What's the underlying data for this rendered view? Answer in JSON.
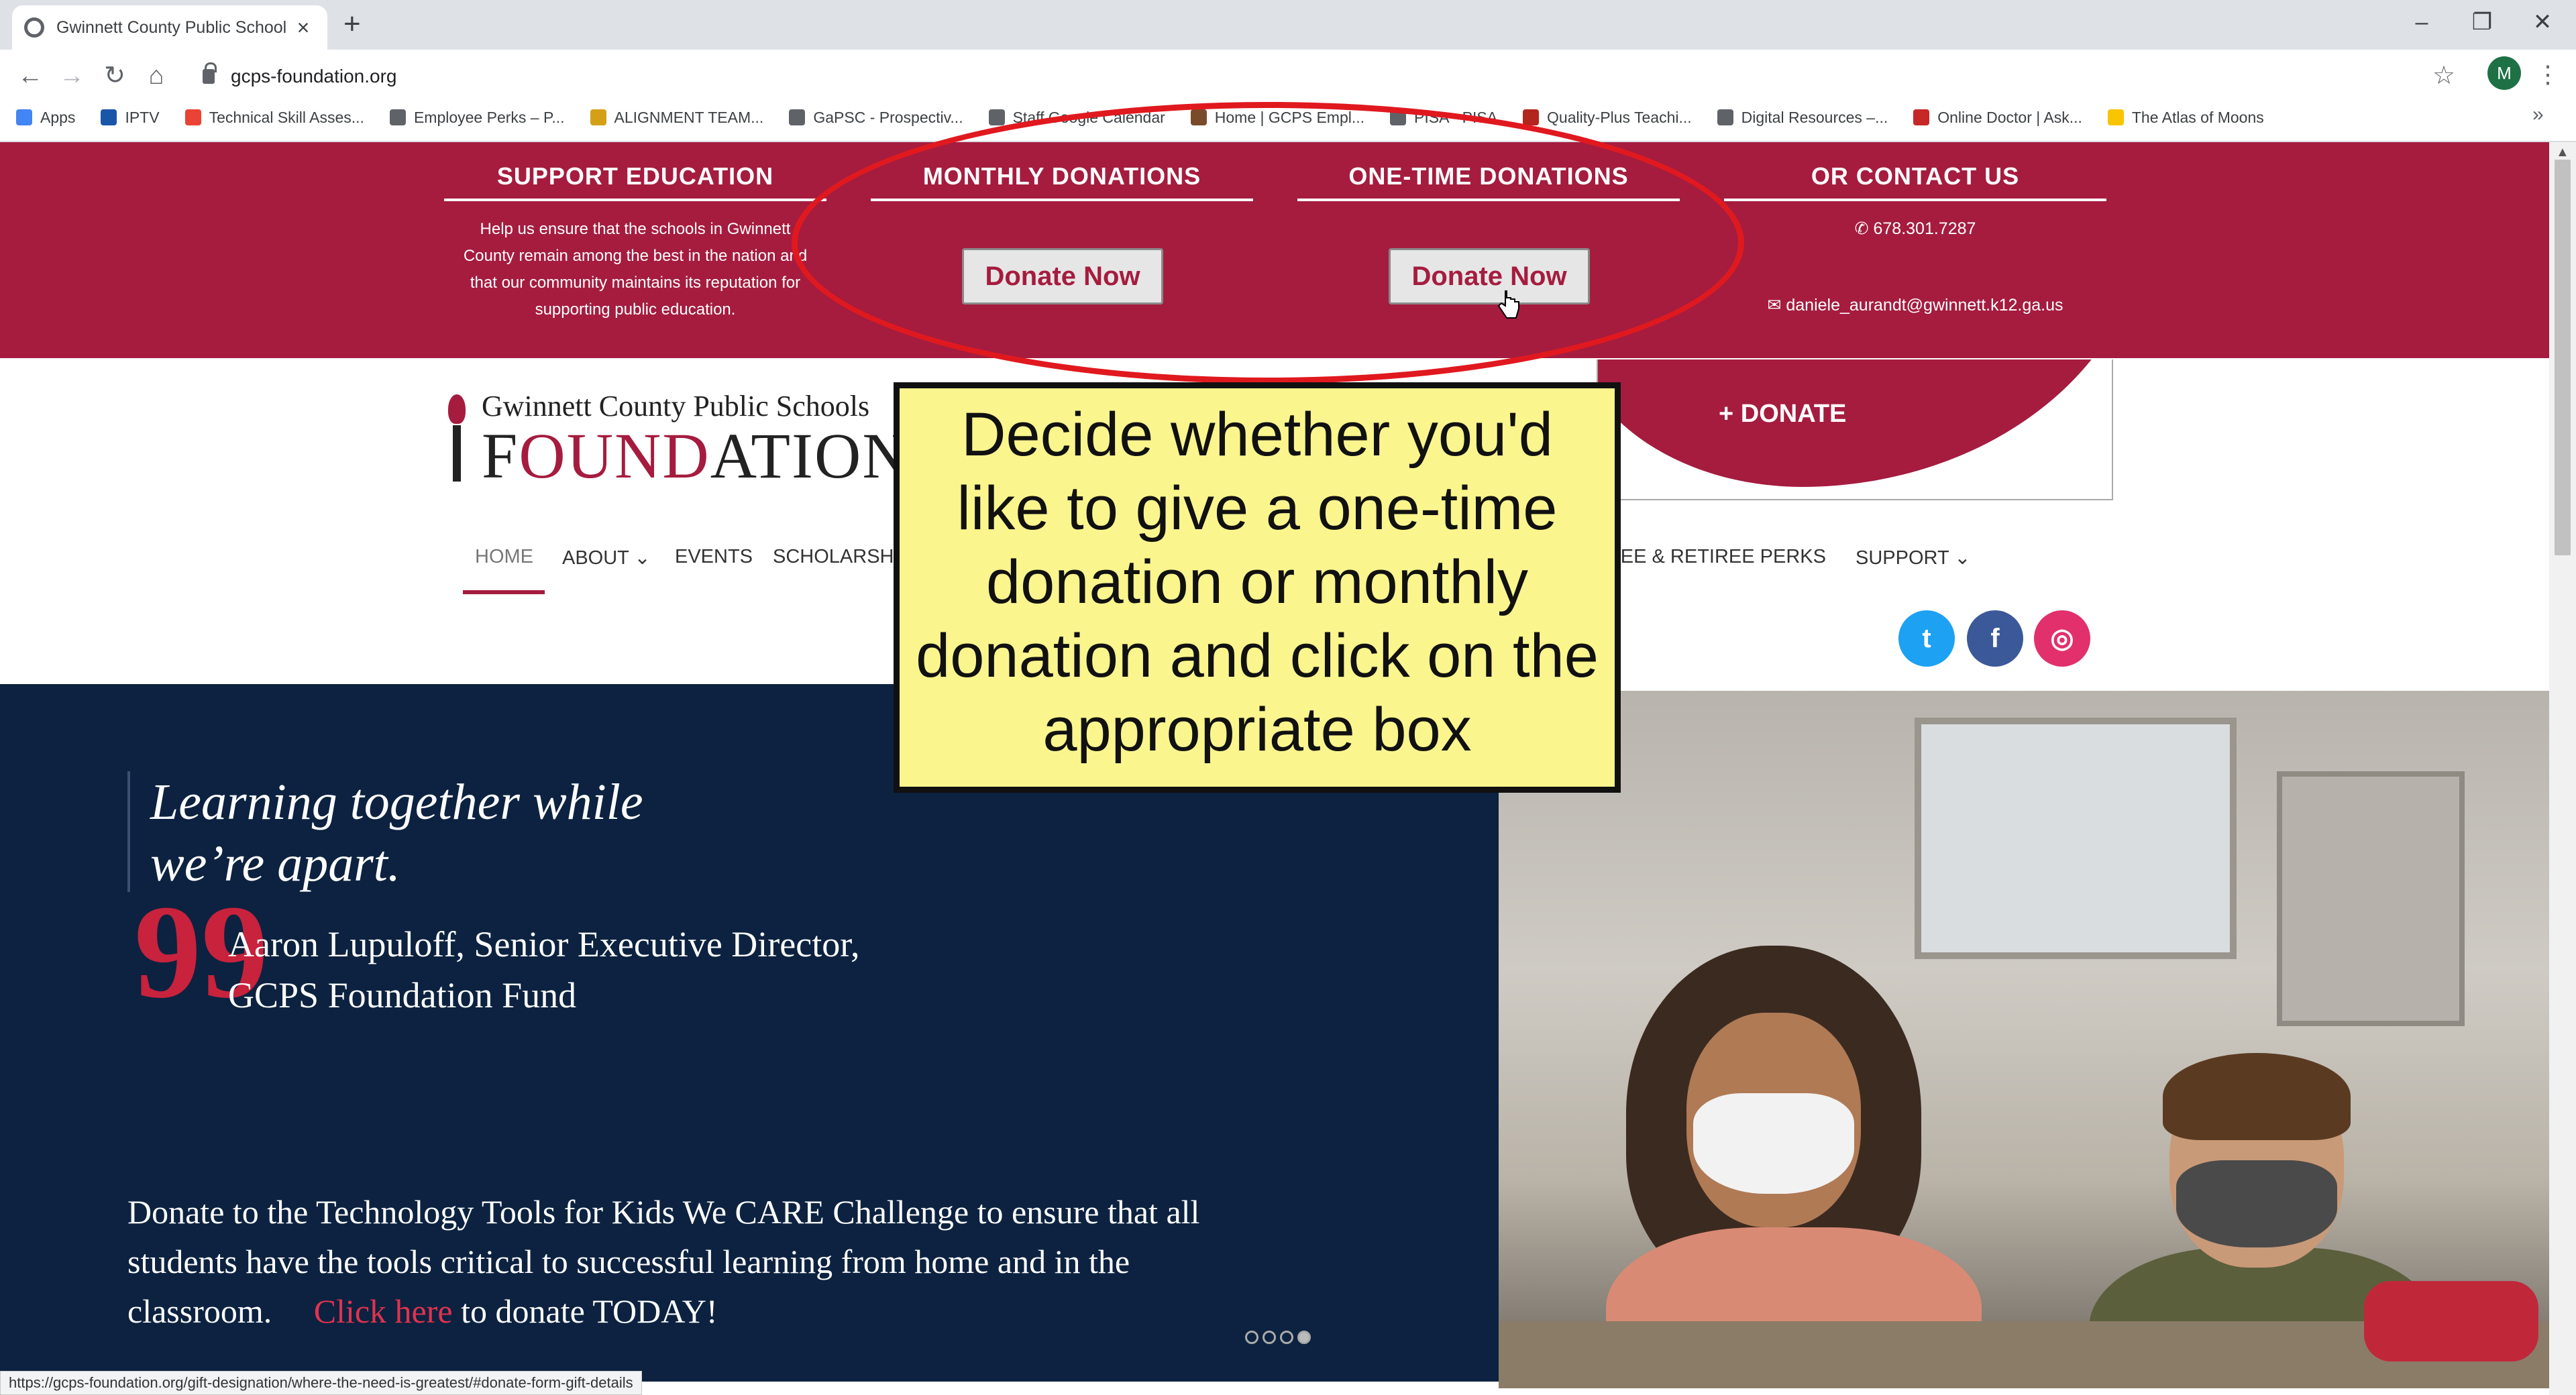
{
  "browser": {
    "tab_title": "Gwinnett County Public School F",
    "tab_close": "×",
    "new_tab": "+",
    "url": "gcps-foundation.org",
    "profile_initial": "M",
    "bookmarks": [
      {
        "label": "Apps",
        "color": "#4285f4"
      },
      {
        "label": "IPTV",
        "color": "#1a56a8"
      },
      {
        "label": "Technical Skill Asses...",
        "color": "#ea4335"
      },
      {
        "label": "Employee Perks – P...",
        "color": "#5f6368"
      },
      {
        "label": "ALIGNMENT TEAM...",
        "color": "#d4a017"
      },
      {
        "label": "GaPSC - Prospectiv...",
        "color": "#5f6368"
      },
      {
        "label": "Staff Google Calendar",
        "color": "#5f6368"
      },
      {
        "label": "Home | GCPS Empl...",
        "color": "#7a4b2a"
      },
      {
        "label": "PISA - PISA",
        "color": "#5f6368"
      },
      {
        "label": "Quality-Plus Teachi...",
        "color": "#b3261e"
      },
      {
        "label": "Digital Resources –...",
        "color": "#5f6368"
      },
      {
        "label": "Online Doctor | Ask...",
        "color": "#c62828"
      },
      {
        "label": "The Atlas of Moons",
        "color": "#f9c400"
      }
    ],
    "bookmarks_more": "»"
  },
  "support_bar": {
    "support_education": {
      "title": "SUPPORT EDUCATION",
      "text": "Help us ensure that the schools in Gwinnett County remain among the best in the nation and that our community maintains its reputation for supporting public education."
    },
    "monthly": {
      "title": "MONTHLY DONATIONS",
      "button": "Donate Now"
    },
    "one_time": {
      "title": "ONE-TIME DONATIONS",
      "button": "Donate Now"
    },
    "contact": {
      "title": "OR CONTACT US",
      "phone": "678.301.7287",
      "email": "daniele_aurandt@gwinnett.k12.ga.us"
    }
  },
  "logo": {
    "top": "Gwinnett County Public Schools",
    "main_a": "F",
    "main_b": "OUND",
    "main_c": "ATION"
  },
  "donate_box_label": "+ DONATE",
  "nav": {
    "home": "HOME",
    "about": "ABOUT ⌄",
    "events": "EVENTS",
    "scholarships": "SCHOLARSHIPS",
    "perks": "EMPLOYEE & RETIREE PERKS",
    "support": "SUPPORT ⌄"
  },
  "social": {
    "twitter": "t",
    "facebook": "f",
    "instagram": "◎",
    "twitter_color": "#1da1f2",
    "facebook_color": "#3b5998",
    "instagram_color": "#e1306c"
  },
  "hero": {
    "quote_line1": "Learning together while",
    "quote_line2": "we’re apart.",
    "quote_mark": "99",
    "author_line1": "Aaron Lupuloff, Senior Executive Director,",
    "author_line2": "GCPS Foundation Fund",
    "cta_text": "Donate to the Technology Tools for Kids We CARE Challenge to ensure that all students have the tools critical to successful learning from home and in the classroom.",
    "cta_link": "Click here",
    "cta_end": "to donate TODAY!"
  },
  "status_url": "https://gcps-foundation.org/gift-designation/where-the-need-is-greatest/#donate-form-gift-details",
  "tutorial": {
    "callout": "Decide whether you'd like to give a one-time donation or monthly donation and click on the appropriate box",
    "ellipse_color": "#e0191f",
    "callout_bg": "#fbf58e"
  },
  "colors": {
    "brand": "#a51c3f",
    "hero_bg": "#0c2240"
  }
}
